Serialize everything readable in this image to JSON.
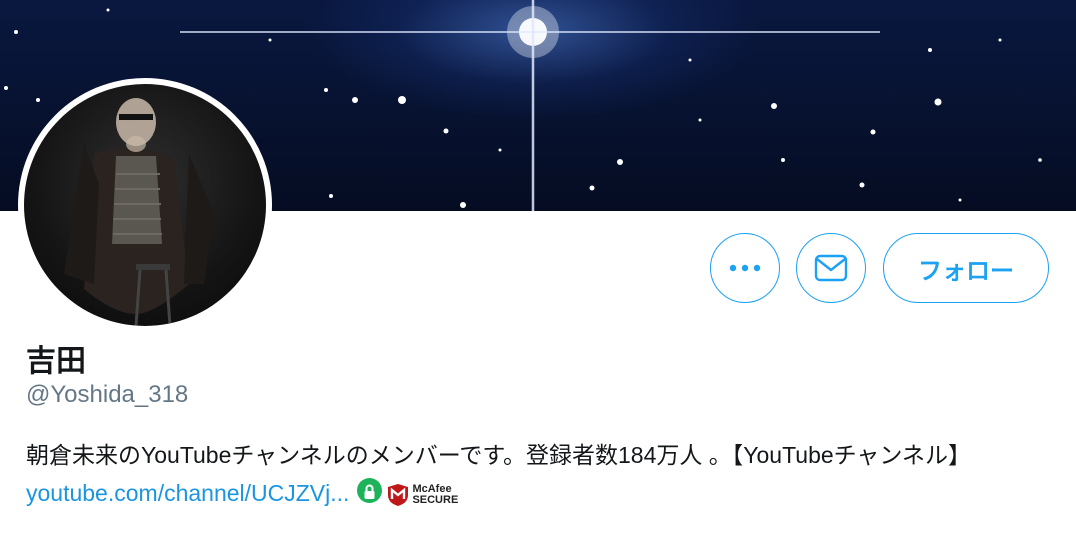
{
  "profile": {
    "name": "吉田",
    "handle": "@Yoshida_318",
    "bio_text": "朝倉未来のYouTubeチャンネルのメンバーです。登録者数184万人 。【YouTubeチャンネル】",
    "bio_link": "youtube.com/channel/UCJZVj...",
    "mcafee_line1": "McAfee",
    "mcafee_line2": "SECURE"
  },
  "actions": {
    "more_label": "•••",
    "follow_label": "フォロー"
  },
  "colors": {
    "accent": "#1da1f2",
    "link": "#1b95e0",
    "secondary_text": "#657786",
    "lock_badge": "#1cb35a",
    "mcafee_red": "#c01818"
  },
  "icons": [
    "more-icon",
    "mail-icon",
    "lock-icon",
    "mcafee-shield-icon"
  ]
}
